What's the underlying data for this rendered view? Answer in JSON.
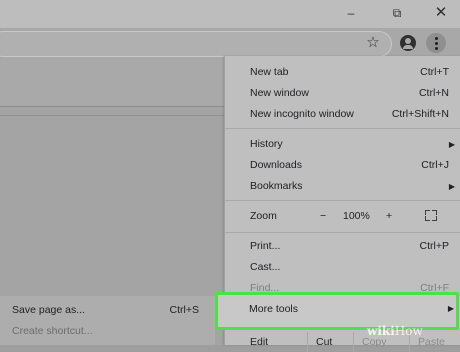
{
  "window_controls": {
    "minimize_icon": "–",
    "restore_icon": "⧉",
    "close_icon": "✕"
  },
  "toolbar": {
    "star_icon": "☆"
  },
  "menu": {
    "new_tab": {
      "label": "New tab",
      "shortcut": "Ctrl+T"
    },
    "new_window": {
      "label": "New window",
      "shortcut": "Ctrl+N"
    },
    "new_incognito": {
      "label": "New incognito window",
      "shortcut": "Ctrl+Shift+N"
    },
    "history": {
      "label": "History"
    },
    "downloads": {
      "label": "Downloads",
      "shortcut": "Ctrl+J"
    },
    "bookmarks": {
      "label": "Bookmarks"
    },
    "zoom": {
      "label": "Zoom",
      "minus": "−",
      "value": "100%",
      "plus": "+"
    },
    "print": {
      "label": "Print...",
      "shortcut": "Ctrl+P"
    },
    "cast": {
      "label": "Cast..."
    },
    "find": {
      "label": "Find...",
      "shortcut": "Ctrl+F"
    },
    "more_tools": {
      "label": "More tools"
    },
    "edit": {
      "label": "Edit",
      "cut": "Cut",
      "copy": "Copy",
      "paste": "Paste"
    },
    "submenu_arrow": "▶"
  },
  "submenu": {
    "save_page": {
      "label": "Save page as...",
      "shortcut": "Ctrl+S"
    },
    "create_shortcut": {
      "label": "Create shortcut..."
    }
  },
  "watermark": {
    "wiki": "wiki",
    "how": "How"
  },
  "colors": {
    "highlight": "#4ee04a"
  }
}
